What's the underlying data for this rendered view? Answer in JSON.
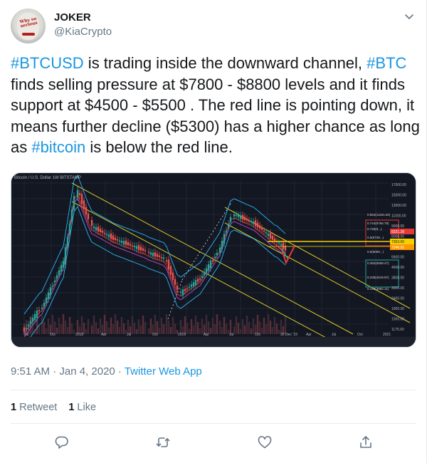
{
  "user": {
    "name": "JOKER",
    "handle": "@KiaCrypto",
    "avatar_text": "Why so serious"
  },
  "tweet": {
    "segments": [
      {
        "text": "#BTCUSD",
        "type": "hashtag"
      },
      {
        "text": " is trading inside the downward channel, ",
        "type": "text"
      },
      {
        "text": "#BTC",
        "type": "hashtag"
      },
      {
        "text": " finds selling pressure at $7800 - $8800 levels and it finds support at $4500 - $5500 . The red line is pointing down, it means further decline ($5300) has a higher chance as long as ",
        "type": "text"
      },
      {
        "text": "#bitcoin",
        "type": "hashtag"
      },
      {
        "text": " is below the red line.",
        "type": "text"
      }
    ]
  },
  "chart": {
    "header": "Bitcoin / U.S. Dollar  1W  BITSTAMP",
    "x_labels": [
      "Jul",
      "Oct",
      "2018",
      "Apr",
      "Jul",
      "Oct",
      "2019",
      "Apr",
      "Jul",
      "Oct",
      "30 Dec '19",
      "Apr",
      "Jul",
      "Oct",
      "2021"
    ],
    "y_labels": [
      "17000.00",
      "15000.00",
      "13000.00",
      "11000.00",
      "9000.00",
      "8000.00",
      "6750.00",
      "5600.00",
      "4600.00",
      "3800.00",
      "3000.00",
      "2400.00",
      "1900.00",
      "1500.00",
      "1175.00"
    ],
    "fib_labels": [
      "0.854(11161.52)",
      "0.744(9766.78)",
      "0.728(9...)",
      "0.6(8739...)",
      "0.5(8059...)",
      "0.382(5558.47)",
      "0.236(4519.97)",
      "0.146(3882.11)"
    ],
    "price_tags": [
      "8321.28",
      "7353.00",
      "7246.00"
    ],
    "bottom_bar": "5y  1y  6m  3m  1m  5d  1d  Go to...",
    "bottom_right": "08:28:01 (UTC+1)  %  log  auto"
  },
  "meta": {
    "time": "9:51 AM · Jan 4, 2020 · ",
    "app": "Twitter Web App"
  },
  "stats": {
    "retweets_count": "1",
    "retweets_label": "Retweet",
    "likes_count": "1",
    "likes_label": "Like"
  },
  "colors": {
    "link": "#1b95e0",
    "muted": "#657786",
    "chart_bg": "#131722"
  }
}
